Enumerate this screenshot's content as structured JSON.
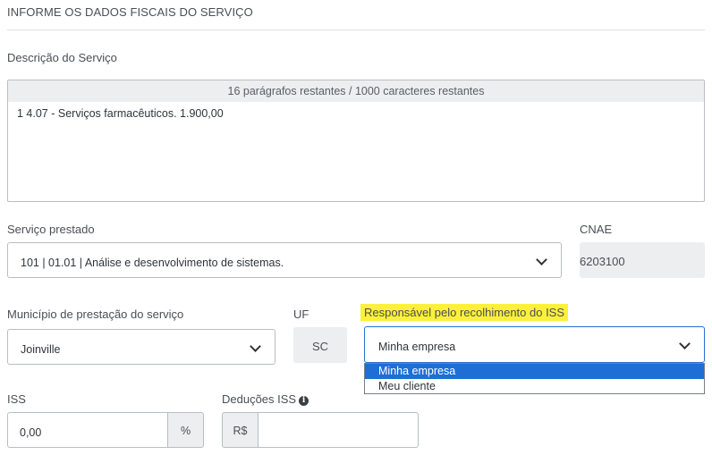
{
  "section": {
    "title": "INFORME OS DADOS FISCAIS DO SERVIÇO"
  },
  "descricao": {
    "label": "Descrição do Serviço",
    "counter": "16 parágrafos restantes / 1000 caracteres restantes",
    "text": "1 4.07 - Serviços farmacêuticos. 1.900,00"
  },
  "servico": {
    "label": "Serviço prestado",
    "value": "101 | 01.01 | Análise e desenvolvimento de sistemas."
  },
  "cnae": {
    "label": "CNAE",
    "value": "6203100"
  },
  "municipio": {
    "label": "Município de prestação do serviço",
    "value": "Joinville"
  },
  "uf": {
    "label": "UF",
    "value": "SC"
  },
  "responsavel": {
    "label": "Responsável pelo recolhimento do ISS",
    "value": "Minha empresa",
    "options": [
      "Minha empresa",
      "Meu cliente"
    ]
  },
  "iss": {
    "label": "ISS",
    "value": "0,00",
    "suffix": "%"
  },
  "deducoes": {
    "label": "Deduções ISS",
    "prefix": "R$",
    "value": ""
  },
  "colors": {
    "highlight": "#fdf03a",
    "selected_option": "#1e6ed6",
    "focus_border": "#2a6fd6"
  }
}
